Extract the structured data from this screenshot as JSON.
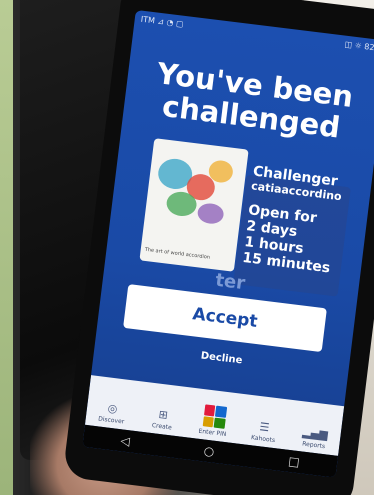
{
  "status_bar": {
    "left": "ITM ⊿ ◔ ▢",
    "right": "◫ ☼ 82%"
  },
  "challenge": {
    "title": "You've been challenged",
    "challenger_label": "Challenger",
    "challenger_name": "catiaaccordino",
    "open_for_label": "Open for",
    "days": "2 days",
    "hours": "1 hours",
    "minutes": "15 minutes",
    "card_caption": "The art of world accordion",
    "background_word": "ter"
  },
  "actions": {
    "accept": "Accept",
    "decline": "Decline"
  },
  "bottom_nav": [
    {
      "label": "Discover",
      "icon": "compass-icon"
    },
    {
      "label": "Create",
      "icon": "plus-square-icon"
    },
    {
      "label": "Enter PIN",
      "icon": "kahoot-shapes-icon"
    },
    {
      "label": "Kahoots",
      "icon": "list-icon"
    },
    {
      "label": "Reports",
      "icon": "bar-chart-icon"
    }
  ],
  "colors": {
    "screen_blue": "#1a4aa6",
    "button_white": "#ffffff"
  }
}
